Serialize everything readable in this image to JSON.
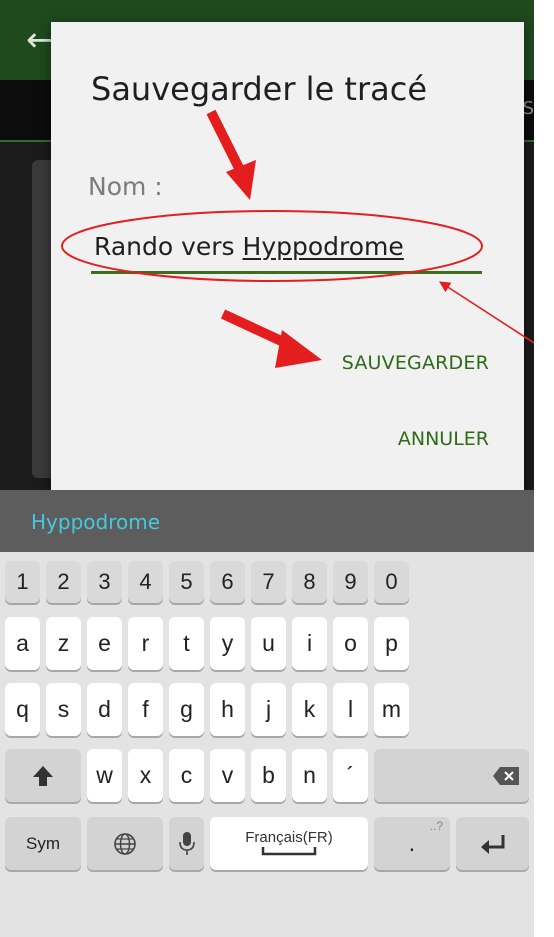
{
  "background": {
    "tab_partial": "GPS"
  },
  "dialog": {
    "title": "Sauvegarder le tracé",
    "name_label": "Nom :",
    "name_value_part1": "Rando vers ",
    "name_value_part2": "Hyppodrome",
    "save_label": "SAUVEGARDER",
    "cancel_label": "ANNULER"
  },
  "keyboard": {
    "suggestion": "Hyppodrome",
    "row_numbers": [
      "1",
      "2",
      "3",
      "4",
      "5",
      "6",
      "7",
      "8",
      "9",
      "0"
    ],
    "row1": [
      "a",
      "z",
      "e",
      "r",
      "t",
      "y",
      "u",
      "i",
      "o",
      "p"
    ],
    "row2": [
      "q",
      "s",
      "d",
      "f",
      "g",
      "h",
      "j",
      "k",
      "l",
      "m"
    ],
    "row3": [
      "w",
      "x",
      "c",
      "v",
      "b",
      "n",
      "´"
    ],
    "sym_label": "Sym",
    "space_label": "Français(FR)",
    "period_label": ".",
    "period_sup": "..?"
  },
  "colors": {
    "accent_green": "#3c6e1e",
    "annotation_red": "#e41e1e",
    "suggestion_cyan": "#45c9de"
  }
}
